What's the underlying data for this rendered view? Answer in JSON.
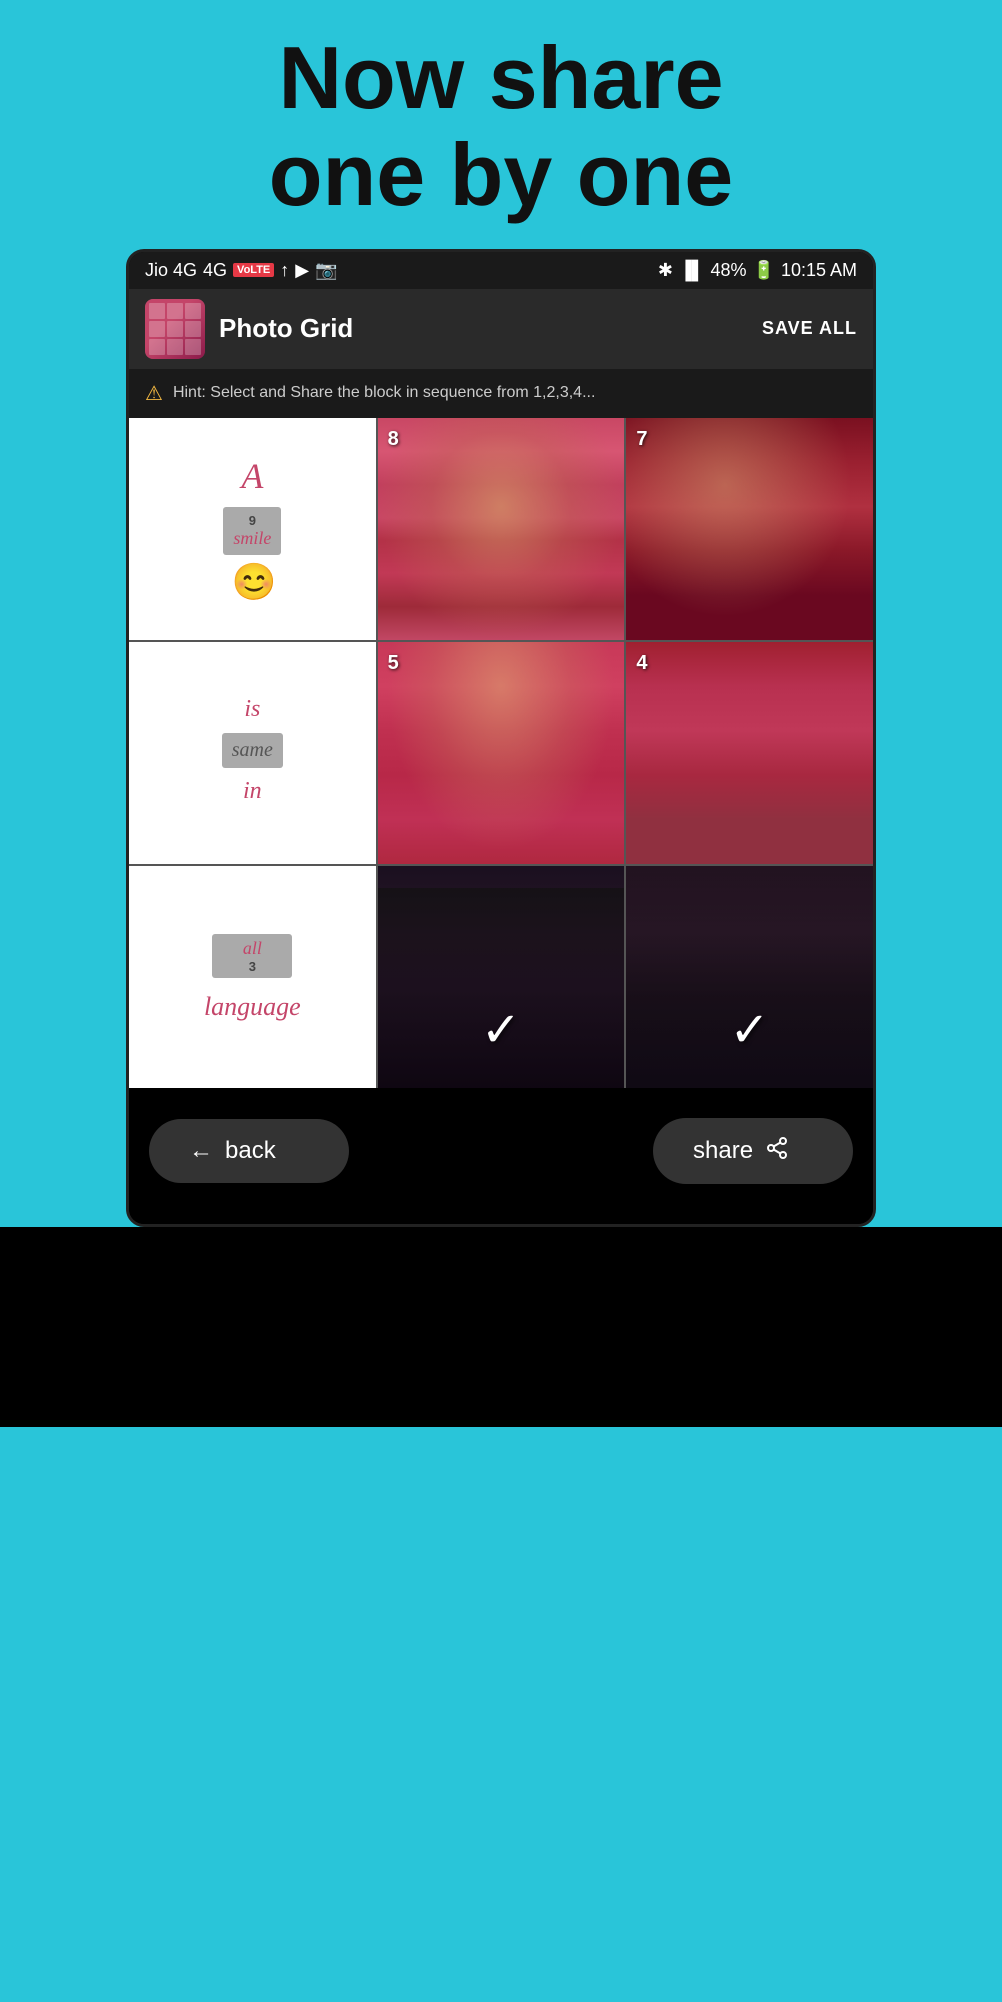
{
  "top": {
    "heading_line1": "Now share",
    "heading_line2": "one by one"
  },
  "status_bar": {
    "carrier": "Jio 4G",
    "volte": "VoLTE",
    "signal_icons": "↑ ▶ 📷",
    "bluetooth": "bluetooth",
    "network": "48%",
    "battery": "48%",
    "time": "10:15 AM"
  },
  "app_header": {
    "title": "Photo Grid",
    "save_all_label": "SAVE ALL"
  },
  "hint": {
    "text": "Hint: Select and Share the block in sequence from 1,2,3,4..."
  },
  "grid": {
    "cells": [
      {
        "id": 9,
        "type": "text",
        "number": "9",
        "lines": [
          "A",
          "smile 😊"
        ]
      },
      {
        "id": 8,
        "type": "photo",
        "number": "8"
      },
      {
        "id": 7,
        "type": "photo",
        "number": "7"
      },
      {
        "id": 6,
        "type": "text",
        "number": null,
        "lines": [
          "is",
          "same",
          "in"
        ]
      },
      {
        "id": 5,
        "type": "photo",
        "number": "5"
      },
      {
        "id": 4,
        "type": "photo",
        "number": "4"
      },
      {
        "id": 3,
        "type": "text",
        "number": "3",
        "lines": [
          "all",
          "language"
        ]
      },
      {
        "id": 2,
        "type": "photo",
        "number": null,
        "checked": true
      },
      {
        "id": 1,
        "type": "photo",
        "number": null,
        "checked": true
      }
    ]
  },
  "buttons": {
    "back_label": "back",
    "share_label": "share"
  }
}
